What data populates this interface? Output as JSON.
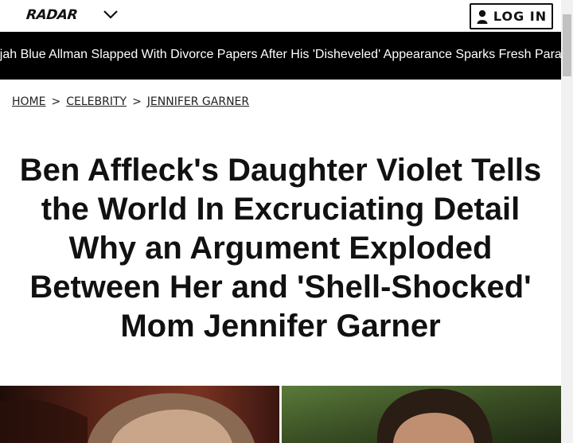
{
  "header": {
    "logo_text": "RADAR",
    "menu_icon": "chevron-down-icon",
    "login_icon": "user-icon",
    "login_label": "LOG IN"
  },
  "ticker": {
    "headline": "Elijah Blue Allman Slapped With Divorce Papers After His 'Disheveled' Appearance Sparks Fresh Paranoia"
  },
  "breadcrumb": {
    "items": [
      "HOME",
      "CELEBRITY",
      "JENNIFER GARNER"
    ],
    "separator": ">"
  },
  "article": {
    "headline": "Ben Affleck's Daughter Violet Tells the World In Excruciating Detail Why an Argument Exploded Between Her and 'Shell-Shocked' Mom Jennifer Garner"
  },
  "colors": {
    "ticker_bg": "#000000",
    "text": "#111111",
    "background": "#ffffff"
  }
}
